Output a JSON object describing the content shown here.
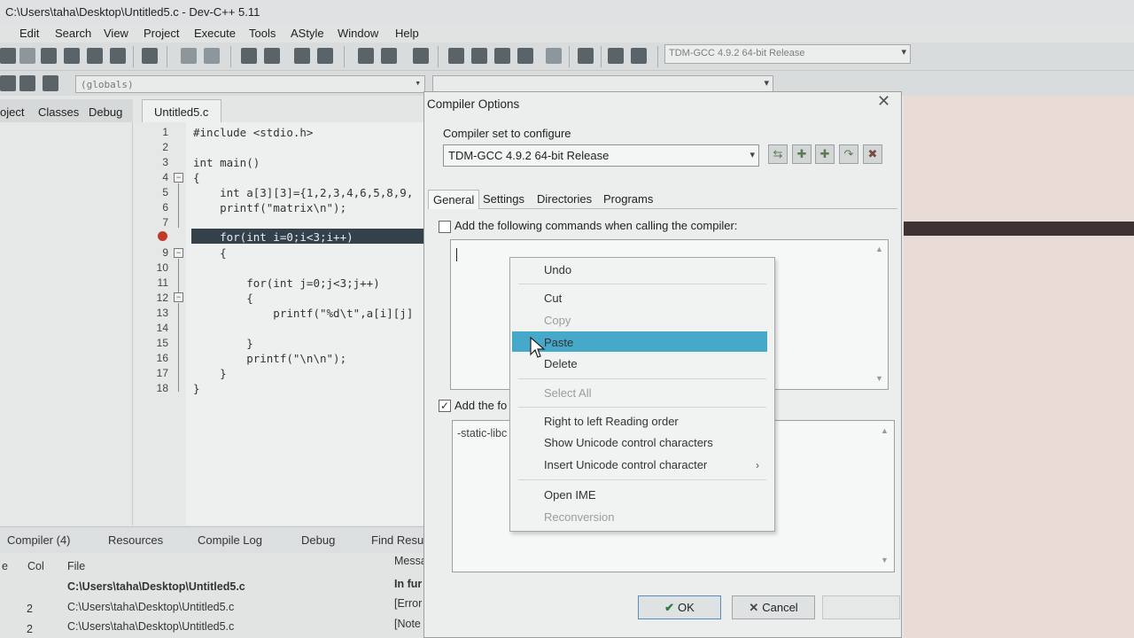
{
  "window": {
    "title": "C:\\Users\\taha\\Desktop\\Untitled5.c - Dev-C++ 5.11"
  },
  "menu": [
    "Edit",
    "Search",
    "View",
    "Project",
    "Execute",
    "Tools",
    "AStyle",
    "Window",
    "Help"
  ],
  "toolbar": {
    "compiler": "TDM-GCC 4.9.2 64-bit Release",
    "scope": "(globals)"
  },
  "left_tabs": [
    "oject",
    "Classes",
    "Debug"
  ],
  "editor": {
    "tab": "Untitled5.c",
    "line_numbers": [
      "1",
      "2",
      "3",
      "4",
      "5",
      "6",
      "7",
      "8",
      "9",
      "10",
      "11",
      "12",
      "13",
      "14",
      "15",
      "16",
      "17",
      "18"
    ],
    "lines": [
      "#include <stdio.h>",
      "",
      "int main()",
      "{",
      "    int a[3][3]={1,2,3,4,6,5,8,9,",
      "    printf(\"matrix\\n\");",
      "",
      "    for(int i=0;i<3;i++)",
      "    {",
      "",
      "        for(int j=0;j<3;j++)",
      "        {",
      "            printf(\"%d\\t\",a[i][j]",
      "",
      "        }",
      "        printf(\"\\n\\n\");",
      "    }",
      "}"
    ]
  },
  "bottom": {
    "tabs": [
      "Compiler (4)",
      "Resources",
      "Compile Log",
      "Debug",
      "Find Resu"
    ],
    "headers": {
      "line": "e",
      "col": "Col",
      "file": "File",
      "message": "Messa"
    },
    "rows": [
      {
        "line": "",
        "col": "",
        "file": "C:\\Users\\taha\\Desktop\\Untitled5.c",
        "message": "In fur"
      },
      {
        "line": "",
        "col": "2",
        "file": "C:\\Users\\taha\\Desktop\\Untitled5.c",
        "message": "[Error"
      },
      {
        "line": "",
        "col": "2",
        "file": "C:\\Users\\taha\\Desktop\\Untitled5.c",
        "message": "[Note"
      }
    ]
  },
  "dialog": {
    "title": "Compiler Options",
    "set_label": "Compiler set to configure",
    "set_value": "TDM-GCC 4.9.2 64-bit Release",
    "tabs": [
      "General",
      "Settings",
      "Directories",
      "Programs"
    ],
    "check1_label": "Add the following commands when calling the compiler:",
    "check1_checked": false,
    "check2_label": "Add the fo",
    "check2_checked": true,
    "text2_value": "-static-libc",
    "ok_label": "OK",
    "cancel_label": "Cancel"
  },
  "context_menu": {
    "items": [
      {
        "label": "Undo",
        "enabled": true
      },
      {
        "label": "Cut",
        "enabled": true
      },
      {
        "label": "Copy",
        "enabled": false
      },
      {
        "label": "Paste",
        "enabled": true,
        "highlighted": true
      },
      {
        "label": "Delete",
        "enabled": true
      },
      {
        "label": "Select All",
        "enabled": false
      },
      {
        "label": "Right to left Reading order",
        "enabled": true
      },
      {
        "label": "Show Unicode control characters",
        "enabled": true
      },
      {
        "label": "Insert Unicode control character",
        "enabled": true
      },
      {
        "label": "Open IME",
        "enabled": true
      },
      {
        "label": "Reconversion",
        "enabled": false
      }
    ]
  },
  "colors": {
    "highlight": "#47a9c9",
    "current_line": "#34404a"
  }
}
